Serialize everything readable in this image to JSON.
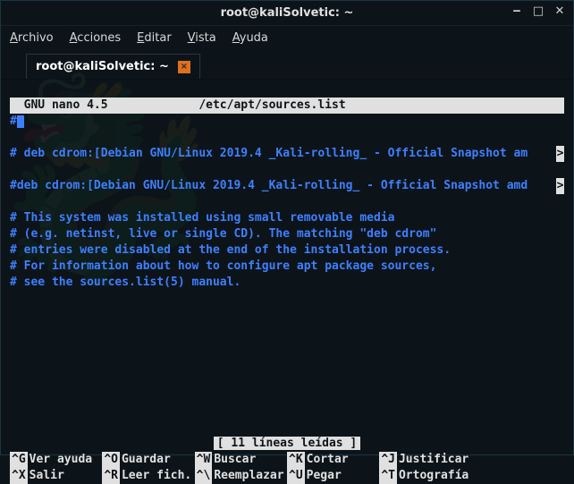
{
  "window": {
    "title": "root@kaliSolvetic: ~"
  },
  "menubar": {
    "items": [
      {
        "underline": "A",
        "rest": "rchivo"
      },
      {
        "underline": "A",
        "rest": "cciones"
      },
      {
        "underline": "E",
        "rest": "ditar"
      },
      {
        "underline": "V",
        "rest": "ista"
      },
      {
        "underline": "A",
        "rest": "yuda"
      }
    ]
  },
  "tab": {
    "label": "root@kaliSolvetic: ~"
  },
  "nano": {
    "app": "  GNU nano 4.5",
    "file": "/etc/apt/sources.list"
  },
  "lines": {
    "l0_hash": "#",
    "l1": "# deb cdrom:[Debian GNU/Linux 2019.4 _Kali-rolling_ - Official Snapshot am",
    "l2": "#deb cdrom:[Debian GNU/Linux 2019.4 _Kali-rolling_ - Official Snapshot amd",
    "l3": "# This system was installed using small removable media",
    "l4": "# (e.g. netinst, live or single CD). The matching \"deb cdrom\"",
    "l5": "# entries were disabled at the end of the installation process.",
    "l6": "# For information about how to configure apt package sources,",
    "l7": "# see the sources.list(5) manual."
  },
  "status": "[ 11 líneas leídas ]",
  "shortcuts": {
    "r1c1": {
      "key": "^G",
      "label": "Ver ayuda"
    },
    "r1c2": {
      "key": "^O",
      "label": "Guardar"
    },
    "r1c3": {
      "key": "^W",
      "label": "Buscar"
    },
    "r1c4": {
      "key": "^K",
      "label": "Cortar"
    },
    "r1c5": {
      "key": "^J",
      "label": "Justificar"
    },
    "r2c1": {
      "key": "^X",
      "label": "Salir"
    },
    "r2c2": {
      "key": "^R",
      "label": "Leer fich."
    },
    "r2c3": {
      "key": "^\\",
      "label": "Reemplazar"
    },
    "r2c4": {
      "key": "^U",
      "label": "Pegar"
    },
    "r2c5": {
      "key": "^T",
      "label": "Ortografía"
    }
  },
  "overflow": ">"
}
